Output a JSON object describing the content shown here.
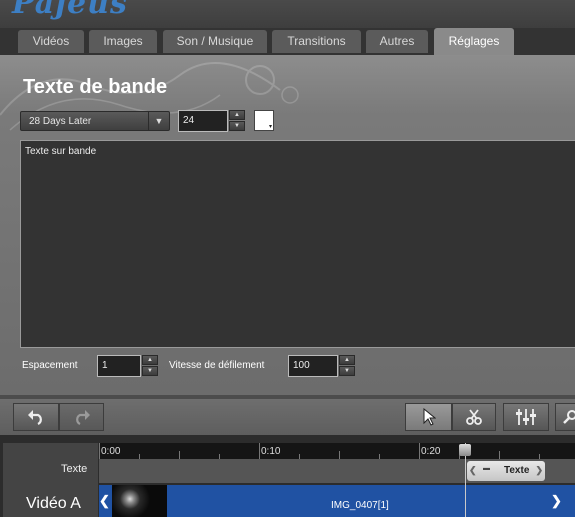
{
  "app": {
    "logo_text": "Pajeus"
  },
  "tabs": [
    {
      "label": "Vidéos"
    },
    {
      "label": "Images"
    },
    {
      "label": "Son / Musique"
    },
    {
      "label": "Transitions"
    },
    {
      "label": "Autres"
    },
    {
      "label": "Réglages",
      "active": true
    }
  ],
  "panel": {
    "title": "Texte de bande",
    "font_select": {
      "value": "28 Days Later"
    },
    "font_size": {
      "value": "24"
    },
    "text_color": "#ffffff",
    "text_content": "Texte sur bande",
    "spacing": {
      "label": "Espacement",
      "value": "1"
    },
    "scroll_speed": {
      "label": "Vitesse de défilement",
      "value": "100"
    }
  },
  "toolbar": {
    "undo_icon": "undo-icon",
    "redo_icon": "redo-icon",
    "select_icon": "cursor-arrow-icon",
    "cut_icon": "scissors-icon",
    "mixer_icon": "sliders-icon"
  },
  "timeline": {
    "ruler_labels": [
      "0:00",
      "0:10",
      "0:20"
    ],
    "tracks": [
      {
        "label": "Texte"
      },
      {
        "label": "Vidéo A"
      }
    ],
    "text_clip": {
      "label": "Texte"
    },
    "video_clip": {
      "label": "IMG_0407[1]"
    },
    "accent_color": "#2052a3"
  }
}
